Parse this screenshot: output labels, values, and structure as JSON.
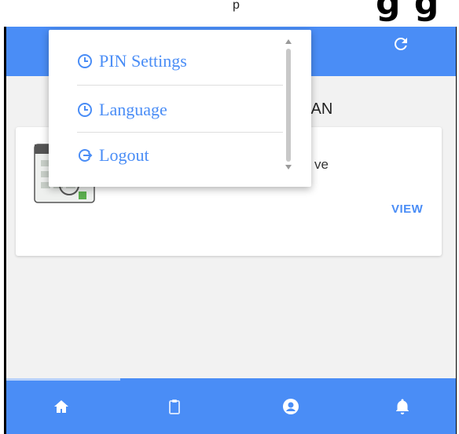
{
  "top_banner": {
    "partial_text": "p",
    "partial_bold": "g g"
  },
  "header": {
    "refresh_icon": "refresh-icon",
    "color": "#4a8df6"
  },
  "user": {
    "name_partial": "IAN"
  },
  "card": {
    "description_partial": "ve",
    "view_label": "VIEW",
    "icon": "calendar-icon"
  },
  "dropdown": {
    "items": [
      {
        "label": "PIN Settings",
        "icon": "clock-icon"
      },
      {
        "label": "Language",
        "icon": "clock-icon"
      },
      {
        "label": "Logout",
        "icon": "logout-icon"
      }
    ]
  },
  "bottom_nav": {
    "items": [
      {
        "name": "home",
        "icon": "home-icon"
      },
      {
        "name": "clipboard",
        "icon": "clipboard-icon"
      },
      {
        "name": "profile",
        "icon": "user-icon"
      },
      {
        "name": "notifications",
        "icon": "bell-icon"
      }
    ]
  }
}
